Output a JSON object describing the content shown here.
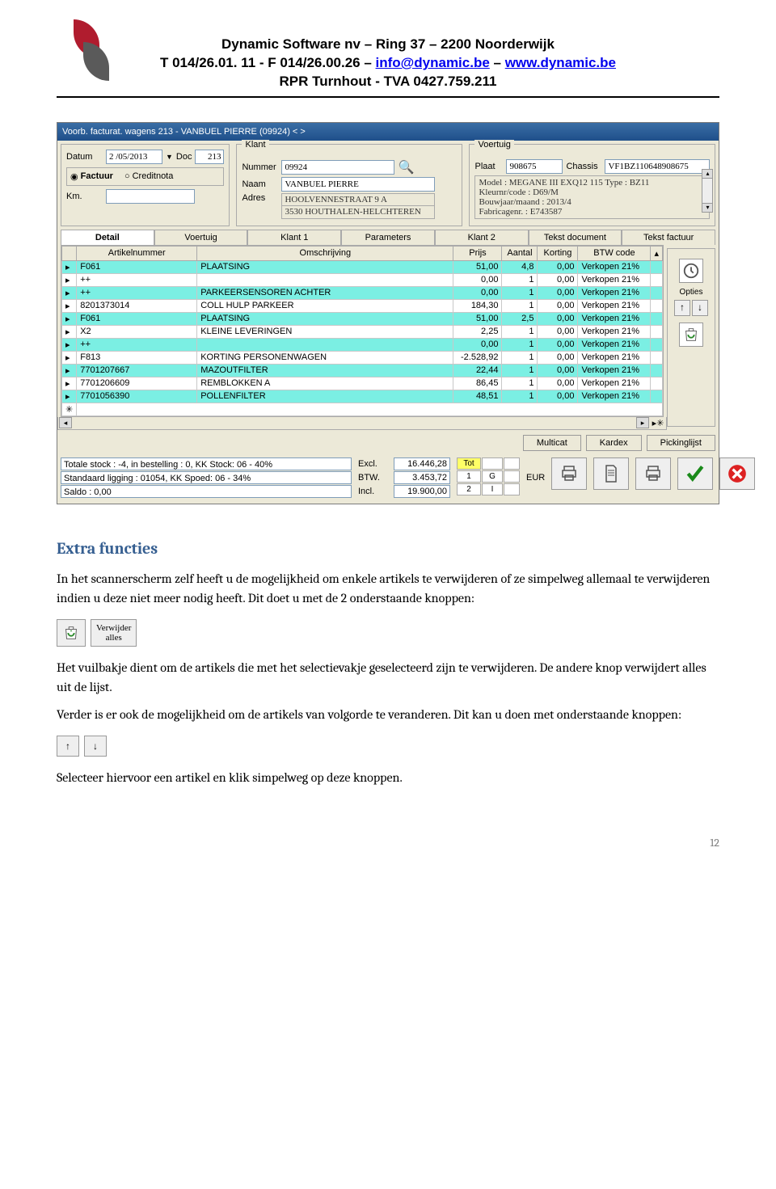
{
  "letterhead": {
    "line1": "Dynamic Software nv – Ring 37 – 2200 Noorderwijk",
    "line2_a": "T 014/26.01. 11 - F 014/26.00.26 – ",
    "email": "info@dynamic.be",
    "line2_c": " – ",
    "site": "www.dynamic.be",
    "line3": "RPR Turnhout - TVA 0427.759.211"
  },
  "window": {
    "title": "Voorb. facturat. wagens 213 - VANBUEL PIERRE (09924) < >",
    "left": {
      "date_lbl": "Datum",
      "date_val": "2 /05/2013",
      "doc_lbl": "Doc",
      "doc_val": "213",
      "radio1": "Factuur",
      "radio2": "Creditnota",
      "km_lbl": "Km."
    },
    "mid": {
      "fieldset": "Klant",
      "nummer_lbl": "Nummer",
      "nummer_val": "09924",
      "naam_lbl": "Naam",
      "naam_val": "VANBUEL PIERRE",
      "adres_lbl": "Adres",
      "adres_val1": "HOOLVENNESTRAAT 9 A",
      "adres_val2": "3530 HOUTHALEN-HELCHTEREN"
    },
    "right": {
      "fieldset": "Voertuig",
      "plaat_lbl": "Plaat",
      "plaat_val": "908675",
      "chassis_lbl": "Chassis",
      "chassis_val": "VF1BZ110648908675",
      "l1": "Model : MEGANE III EXQ12 115 Type : BZ11",
      "l2": "Kleurnr/code : D69/M",
      "l3": "Bouwjaar/maand : 2013/4",
      "l4": "Fabricagenr. : E743587"
    },
    "tabs": [
      "Detail",
      "Voertuig",
      "Klant 1",
      "Parameters",
      "Klant 2",
      "Tekst document",
      "Tekst factuur"
    ],
    "columns": [
      "Artikelnummer",
      "Omschrijving",
      "Prijs",
      "Aantal",
      "Korting",
      "BTW code"
    ],
    "rows": [
      {
        "hl": true,
        "art": "F061",
        "oms": "PLAATSING",
        "prijs": "51,00",
        "aantal": "4,8",
        "korting": "0,00",
        "btw": "Verkopen 21%"
      },
      {
        "hl": false,
        "art": "++",
        "oms": "",
        "prijs": "0,00",
        "aantal": "1",
        "korting": "0,00",
        "btw": "Verkopen 21%"
      },
      {
        "hl": true,
        "art": "++",
        "oms": "PARKEERSENSOREN ACHTER",
        "prijs": "0,00",
        "aantal": "1",
        "korting": "0,00",
        "btw": "Verkopen 21%"
      },
      {
        "hl": false,
        "art": "8201373014",
        "oms": "COLL HULP PARKEER",
        "prijs": "184,30",
        "aantal": "1",
        "korting": "0,00",
        "btw": "Verkopen 21%"
      },
      {
        "hl": true,
        "art": "F061",
        "oms": "PLAATSING",
        "prijs": "51,00",
        "aantal": "2,5",
        "korting": "0,00",
        "btw": "Verkopen 21%"
      },
      {
        "hl": false,
        "art": "X2",
        "oms": "KLEINE LEVERINGEN",
        "prijs": "2,25",
        "aantal": "1",
        "korting": "0,00",
        "btw": "Verkopen 21%"
      },
      {
        "hl": true,
        "art": "++",
        "oms": "",
        "prijs": "0,00",
        "aantal": "1",
        "korting": "0,00",
        "btw": "Verkopen 21%"
      },
      {
        "hl": false,
        "art": "F813",
        "oms": "KORTING PERSONENWAGEN",
        "prijs": "-2.528,92",
        "aantal": "1",
        "korting": "0,00",
        "btw": "Verkopen 21%"
      },
      {
        "hl": true,
        "art": "7701207667",
        "oms": "MAZOUTFILTER",
        "prijs": "22,44",
        "aantal": "1",
        "korting": "0,00",
        "btw": "Verkopen 21%"
      },
      {
        "hl": false,
        "art": "7701206609",
        "oms": "REMBLOKKEN A",
        "prijs": "86,45",
        "aantal": "1",
        "korting": "0,00",
        "btw": "Verkopen 21%"
      },
      {
        "hl": true,
        "art": "7701056390",
        "oms": "POLLENFILTER",
        "prijs": "48,51",
        "aantal": "1",
        "korting": "0,00",
        "btw": "Verkopen 21%"
      }
    ],
    "side": {
      "opties": "Opties"
    },
    "footer_btns": {
      "multicat": "Multicat",
      "kardex": "Kardex",
      "pickinglist": "Pickinglijst"
    },
    "summary": {
      "l1": "Totale stock : -4, in bestelling : 0, KK Stock: 06 - 40%",
      "l2": "Standaard ligging : 01054, KK Spoed: 06 - 34%",
      "l3": "Saldo : 0,00"
    },
    "totals": {
      "excl_lbl": "Excl.",
      "excl_val": "16.446,28",
      "btw_lbl": "BTW.",
      "btw_val": "3.453,72",
      "incl_lbl": "Incl.",
      "incl_val": "19.900,00"
    },
    "tot_box": {
      "tot": "Tot",
      "g": "G",
      "i": "I",
      "v1": "1",
      "v2": "2"
    },
    "eur": "EUR"
  },
  "text": {
    "h2": "Extra functies",
    "p1": "In het scannerscherm zelf heeft u de mogelijkheid om enkele artikels te verwijderen of ze simpelweg allemaal te verwijderen indien u deze niet meer nodig heeft. Dit doet u met de 2 onderstaande knoppen:",
    "btn_vw_alles": "Verwijder\nalles",
    "p2": "Het vuilbakje dient om de artikels die met het selectievakje geselecteerd zijn te verwijderen. De andere knop verwijdert alles uit de lijst.",
    "p3": "Verder is er ook de mogelijkheid om de artikels van volgorde te veranderen. Dit kan u doen met onderstaande knoppen:",
    "p4": "Selecteer hiervoor een artikel en klik simpelweg op deze knoppen."
  },
  "pagenum": "12"
}
